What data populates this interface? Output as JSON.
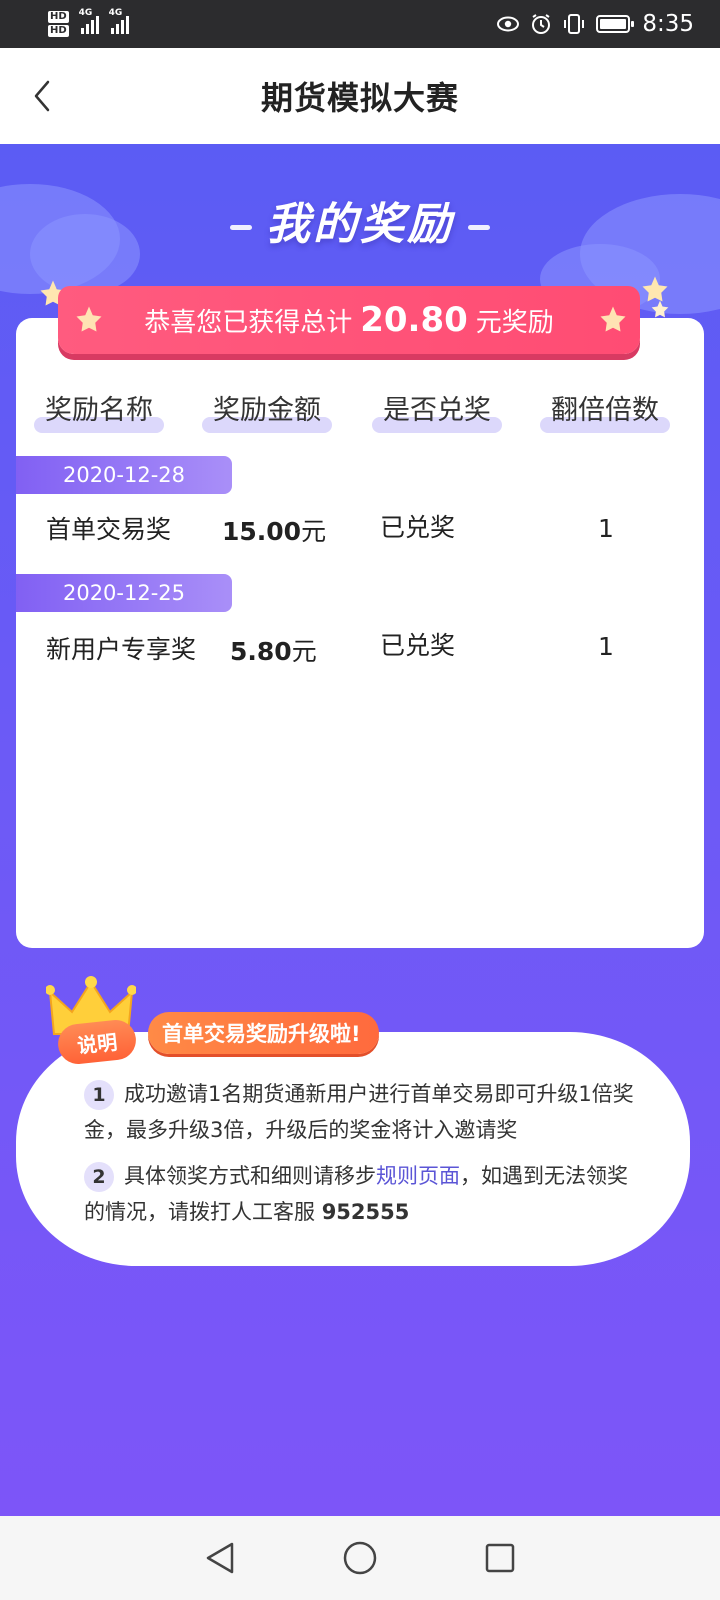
{
  "status_bar": {
    "hd1": "HD",
    "hd2": "HD",
    "net1": "4G",
    "net2": "4G",
    "time": "8:35"
  },
  "header": {
    "title": "期货模拟大赛"
  },
  "rewards": {
    "section_title": "我的奖励",
    "banner_prefix": "恭喜您已获得总计",
    "banner_amount": "20.80",
    "banner_suffix": "元奖励",
    "columns": [
      "奖励名称",
      "奖励金额",
      "是否兑奖",
      "翻倍倍数"
    ],
    "items": [
      {
        "date": "2020-12-28",
        "name": "首单交易奖",
        "amount": "15.00",
        "unit": "元",
        "status": "已兑奖",
        "multiplier": "1"
      },
      {
        "date": "2020-12-25",
        "name": "新用户专享奖",
        "amount": "5.80",
        "unit": "元",
        "status": "已兑奖",
        "multiplier": "1"
      }
    ]
  },
  "notes": {
    "crown_label": "说明",
    "headline": "首单交易奖励升级啦!",
    "items": [
      {
        "num": "1",
        "text": "成功邀请1名期货通新用户进行首单交易即可升级1倍奖金，最多升级3倍，升级后的奖金将计入邀请奖"
      },
      {
        "num": "2",
        "text_before": "具体领奖方式和细则请移步",
        "link": "规则页面",
        "text_after": "，如遇到无法领奖的情况，请拨打人工客服 ",
        "phone": "952555"
      }
    ]
  },
  "colors": {
    "bg_top": "#5b5cf4",
    "bg_bottom": "#7d55f8",
    "banner": "#ff4c73",
    "accent_orange": "#ff6a3d",
    "link": "#5b55d6"
  }
}
